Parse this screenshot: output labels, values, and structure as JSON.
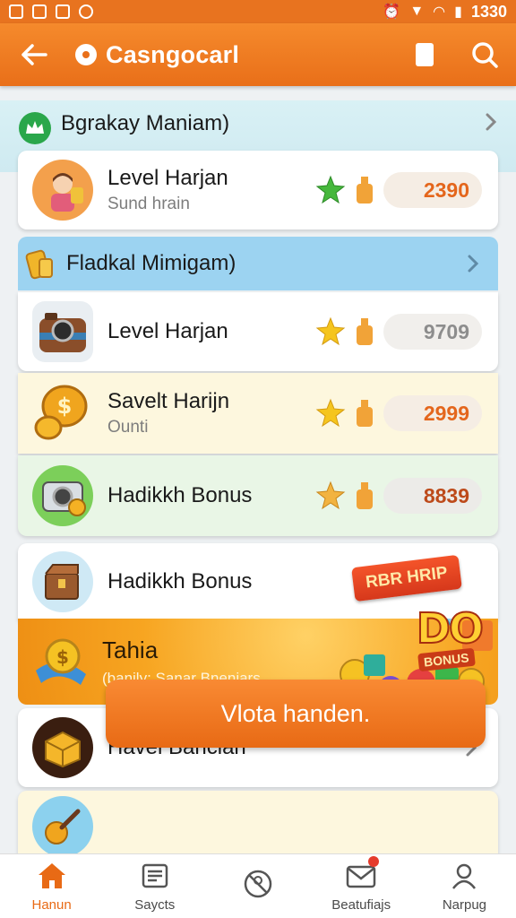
{
  "status_bar": {
    "time": "1330"
  },
  "app_bar": {
    "title": "Casngocarl"
  },
  "sections": [
    {
      "title": "Bgrakay Maniam)"
    },
    {
      "title": "Fladkal Mimigam)"
    }
  ],
  "cards": [
    {
      "title": "Level Harjan",
      "subtitle": "Sund hrain",
      "score": "2390"
    },
    {
      "title": "Level Harjan",
      "subtitle": "",
      "score": "9709"
    },
    {
      "title": "Savelt Harijn",
      "subtitle": "Ounti",
      "score": "2999"
    },
    {
      "title": "Hadikkh Bonus",
      "subtitle": "",
      "score": "8839"
    },
    {
      "title": "Hadikkh Bonus",
      "subtitle": ""
    },
    {
      "title": "Havel Bancian",
      "subtitle": ""
    }
  ],
  "promo": {
    "title": "Tahia",
    "subtitle": "(banily: Sanar Bneniars",
    "tag": "RBR HRIP",
    "art_big": "DO",
    "art_small": "BONUS"
  },
  "cta": {
    "label": "Vlota handen."
  },
  "bottom_nav": [
    {
      "label": "Hanun",
      "icon": "home-icon",
      "active": true
    },
    {
      "label": "Saycts",
      "icon": "list-icon",
      "active": false
    },
    {
      "label": "",
      "icon": "no-entry-icon",
      "active": false
    },
    {
      "label": "Beatufiajs",
      "icon": "mail-icon",
      "active": false
    },
    {
      "label": "Narpug",
      "icon": "profile-icon",
      "active": false
    }
  ],
  "colors": {
    "primary": "#e96f19",
    "accent_blue": "#9cd3f1",
    "score_text": "#e4661c"
  }
}
